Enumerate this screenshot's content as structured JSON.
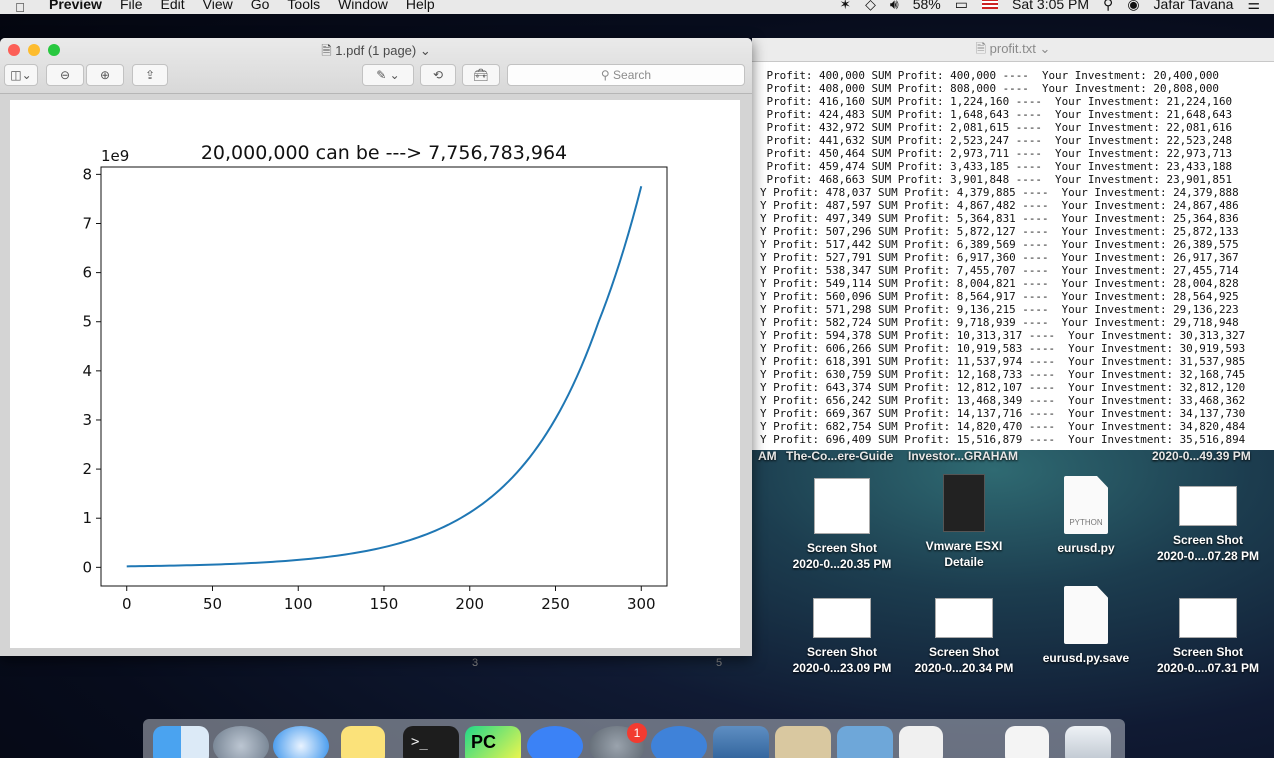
{
  "menubar": {
    "app": "Preview",
    "menus": [
      "File",
      "Edit",
      "View",
      "Go",
      "Tools",
      "Window",
      "Help"
    ],
    "battery": "58%",
    "clock": "Sat 3:05 PM",
    "user": "Jafar Tavana"
  },
  "preview": {
    "title": "1.pdf (1 page)",
    "search_placeholder": "Search"
  },
  "textedit": {
    "title": "profit.txt",
    "lines": [
      " Profit: 400,000 SUM Profit: 400,000 ----  Your Investment: 20,400,000",
      " Profit: 408,000 SUM Profit: 808,000 ----  Your Investment: 20,808,000",
      " Profit: 416,160 SUM Profit: 1,224,160 ----  Your Investment: 21,224,160",
      " Profit: 424,483 SUM Profit: 1,648,643 ----  Your Investment: 21,648,643",
      " Profit: 432,972 SUM Profit: 2,081,615 ----  Your Investment: 22,081,616",
      " Profit: 441,632 SUM Profit: 2,523,247 ----  Your Investment: 22,523,248",
      " Profit: 450,464 SUM Profit: 2,973,711 ----  Your Investment: 22,973,713",
      " Profit: 459,474 SUM Profit: 3,433,185 ----  Your Investment: 23,433,188",
      " Profit: 468,663 SUM Profit: 3,901,848 ----  Your Investment: 23,901,851",
      "Y Profit: 478,037 SUM Profit: 4,379,885 ----  Your Investment: 24,379,888",
      "Y Profit: 487,597 SUM Profit: 4,867,482 ----  Your Investment: 24,867,486",
      "Y Profit: 497,349 SUM Profit: 5,364,831 ----  Your Investment: 25,364,836",
      "Y Profit: 507,296 SUM Profit: 5,872,127 ----  Your Investment: 25,872,133",
      "Y Profit: 517,442 SUM Profit: 6,389,569 ----  Your Investment: 26,389,575",
      "Y Profit: 527,791 SUM Profit: 6,917,360 ----  Your Investment: 26,917,367",
      "Y Profit: 538,347 SUM Profit: 7,455,707 ----  Your Investment: 27,455,714",
      "Y Profit: 549,114 SUM Profit: 8,004,821 ----  Your Investment: 28,004,828",
      "Y Profit: 560,096 SUM Profit: 8,564,917 ----  Your Investment: 28,564,925",
      "Y Profit: 571,298 SUM Profit: 9,136,215 ----  Your Investment: 29,136,223",
      "Y Profit: 582,724 SUM Profit: 9,718,939 ----  Your Investment: 29,718,948",
      "Y Profit: 594,378 SUM Profit: 10,313,317 ----  Your Investment: 30,313,327",
      "Y Profit: 606,266 SUM Profit: 10,919,583 ----  Your Investment: 30,919,593",
      "Y Profit: 618,391 SUM Profit: 11,537,974 ----  Your Investment: 31,537,985",
      "Y Profit: 630,759 SUM Profit: 12,168,733 ----  Your Investment: 32,168,745",
      "Y Profit: 643,374 SUM Profit: 12,812,107 ----  Your Investment: 32,812,120",
      "Y Profit: 656,242 SUM Profit: 13,468,349 ----  Your Investment: 33,468,362",
      "Y Profit: 669,367 SUM Profit: 14,137,716 ----  Your Investment: 34,137,730",
      "Y Profit: 682,754 SUM Profit: 14,820,470 ----  Your Investment: 34,820,484",
      "Y Profit: 696,409 SUM Profit: 15,516,879 ----  Your Investment: 35,516,894"
    ]
  },
  "chart_data": {
    "type": "line",
    "title": "20,000,000 can be ---> 7,756,783,964",
    "xlabel": "",
    "ylabel": "",
    "y_offset_label": "1e9",
    "xlim": [
      -15,
      315
    ],
    "ylim": [
      -0.38,
      8.15
    ],
    "xticks": [
      0,
      50,
      100,
      150,
      200,
      250,
      300
    ],
    "yticks": [
      0,
      1,
      2,
      3,
      4,
      5,
      6,
      7,
      8
    ],
    "color": "#1f77b4",
    "series": [
      {
        "x": [
          0,
          25,
          50,
          75,
          100,
          125,
          150,
          175,
          200,
          225,
          250,
          275,
          300
        ],
        "y": [
          0.0204,
          0.0337,
          0.0555,
          0.0915,
          0.151,
          0.249,
          0.41,
          0.676,
          1.114,
          1.836,
          3.026,
          4.988,
          7.757
        ]
      }
    ]
  },
  "desktop": {
    "top_row": [
      "AM",
      "The-Co...ere-Guide",
      "Investor...GRAHAM",
      "2020-0...49.39 PM"
    ],
    "icons": [
      {
        "name": "Screen Shot",
        "sub": "2020-0...20.35 PM"
      },
      {
        "name": "Vmware ESXI",
        "sub": "Detaile"
      },
      {
        "name": "eurusd.py",
        "sub": "",
        "tag": "PYTHON"
      },
      {
        "name": "Screen Shot",
        "sub": "2020-0....07.28 PM"
      },
      {
        "name": "Screen Shot",
        "sub": "2020-0...23.09 PM"
      },
      {
        "name": "Screen Shot",
        "sub": "2020-0...20.34 PM"
      },
      {
        "name": "eurusd.py.save",
        "sub": ""
      },
      {
        "name": "Screen Shot",
        "sub": "2020-0....07.31 PM"
      }
    ],
    "space_numbers": [
      "3",
      "5"
    ]
  },
  "dock": {
    "badge": "1",
    "terminal_glyph": ">_",
    "pycharm_glyph": "PC"
  }
}
